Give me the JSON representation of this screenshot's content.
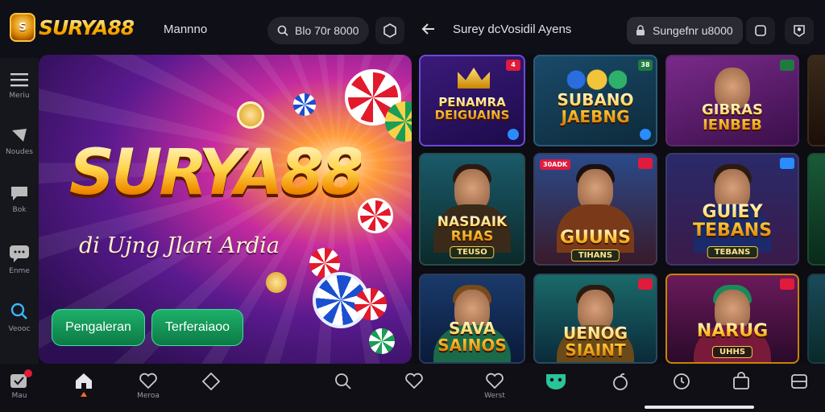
{
  "brand": {
    "name": "SURYA88",
    "badge_text": "S"
  },
  "topbar": {
    "menu_label": "Mannno",
    "search_text": "Blo 70r 8000",
    "page_title": "Surey dcVosidil Ayens",
    "user_text": "Sungefnr u8000"
  },
  "sidebar": {
    "items": [
      {
        "label": "Meriu",
        "icon": "menu-icon"
      },
      {
        "label": "Noudes",
        "icon": "inbox-icon"
      },
      {
        "label": "Bok",
        "icon": "chat-icon"
      },
      {
        "label": "Enme",
        "icon": "message-icon"
      },
      {
        "label": "Veooc",
        "icon": "search-icon"
      },
      {
        "label": "Mau",
        "icon": "notification-icon"
      }
    ]
  },
  "hero": {
    "title": "SURYA88",
    "subtitle": "di Ujng Jlari Ardia",
    "primary_button": "Pengaleran",
    "secondary_button": "Terferaiaoo"
  },
  "games": [
    {
      "title": "PENAMRA DEIGUAINS",
      "tag": "",
      "badge_left": "",
      "badge_right": "4"
    },
    {
      "title": "SUBANO JAEBNG",
      "tag": "",
      "badge_left": "",
      "badge_right": "38"
    },
    {
      "title": "GIBRAS IENBEB",
      "tag": "",
      "badge_left": "",
      "badge_right": ""
    },
    {
      "title": "NASDAIK RHAS",
      "tag": "TEUSO",
      "badge_left": "",
      "badge_right": ""
    },
    {
      "title": "GUUNS",
      "tag": "TIHANS",
      "badge_left": "30ADK",
      "badge_right": ""
    },
    {
      "title": "GUIEY TEBANS",
      "tag": "TEBANS",
      "badge_left": "",
      "badge_right": ""
    },
    {
      "title": "SAVA SAINOS",
      "tag": "",
      "badge_left": "",
      "badge_right": ""
    },
    {
      "title": "UENOG SIAINT",
      "tag": "",
      "badge_left": "",
      "badge_right": ""
    },
    {
      "title": "NARUG",
      "tag": "UHHS",
      "badge_left": "",
      "badge_right": ""
    }
  ],
  "bottom_nav": {
    "items": [
      {
        "label": "Mau",
        "icon": "notification-icon"
      },
      {
        "label": "",
        "icon": "home-icon"
      },
      {
        "label": "Meroa",
        "icon": "heart-icon"
      },
      {
        "label": "",
        "icon": "tag-icon"
      },
      {
        "label": "",
        "icon": "search-icon"
      },
      {
        "label": "",
        "icon": "favorite-icon"
      },
      {
        "label": "Werst",
        "icon": "heart-icon"
      },
      {
        "label": "",
        "icon": "mask-icon"
      },
      {
        "label": "",
        "icon": "apple-icon"
      },
      {
        "label": "",
        "icon": "clock-icon"
      },
      {
        "label": "",
        "icon": "bag-icon"
      },
      {
        "label": "",
        "icon": "wallet-icon"
      }
    ]
  },
  "colors": {
    "accent_green": "#1db06a",
    "brand_gold": "#ffc933",
    "badge_red": "#e01b3c"
  }
}
